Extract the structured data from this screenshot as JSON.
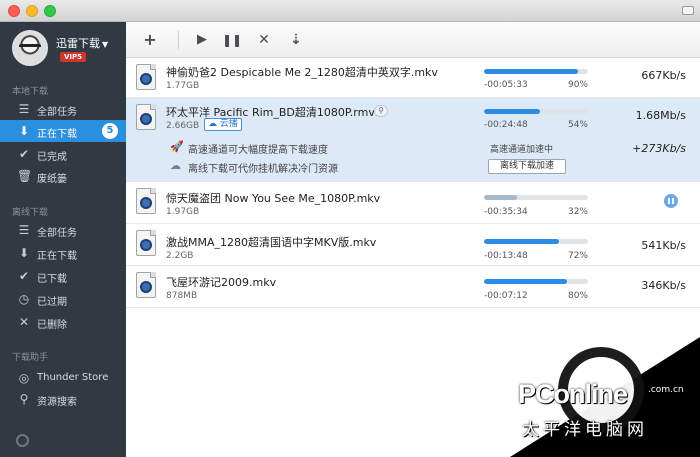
{
  "user": {
    "name": "迅雷下载",
    "vip": "VIP5"
  },
  "sidebar": {
    "sections": [
      {
        "title": "本地下载",
        "items": [
          {
            "icon": "list-icon",
            "label": "全部任务"
          },
          {
            "icon": "download-icon",
            "label": "正在下载",
            "badge": "5"
          },
          {
            "icon": "check-icon",
            "label": "已完成"
          },
          {
            "icon": "trash-icon",
            "label": "废纸篓"
          }
        ]
      },
      {
        "title": "离线下载",
        "items": [
          {
            "icon": "list-icon",
            "label": "全部任务"
          },
          {
            "icon": "download-icon",
            "label": "正在下载"
          },
          {
            "icon": "check-icon",
            "label": "已下载"
          },
          {
            "icon": "clock-icon",
            "label": "已过期"
          },
          {
            "icon": "close-icon",
            "label": "已删除"
          }
        ]
      },
      {
        "title": "下载助手",
        "items": [
          {
            "icon": "thunder-store-icon",
            "label": "Thunder Store"
          },
          {
            "icon": "search-icon",
            "label": "资源搜索"
          }
        ]
      }
    ]
  },
  "toolbar": {
    "add": "+",
    "start": "▶",
    "pause": "❚❚",
    "delete": "✕",
    "sort": "⇣"
  },
  "tasks": [
    {
      "name": "神偷奶爸2 Despicable Me 2_1280超清中英双字.mkv",
      "size": "1.77GB",
      "eta": "-00:05:33",
      "percent": "90%",
      "progress": 0.9,
      "speed": "667Kb/s"
    },
    {
      "name": "环太平洋 Pacific Rim_BD超清1080P.rmvb",
      "size": "2.66GB",
      "eta": "-00:24:48",
      "percent": "54%",
      "progress": 0.54,
      "speed": "1.68Mb/s",
      "cloud_tag": "云播",
      "sub1": "高速通道可大幅度提高下载速度",
      "sub1_status": "高速通道加速中",
      "sub1_speed": "+273Kb/s",
      "sub2": "离线下载可代你挂机解决冷门资源",
      "sub2_button": "离线下载加速"
    },
    {
      "name": "惊天魔盗团 Now You See Me_1080P.mkv",
      "size": "1.97GB",
      "eta": "-00:35:34",
      "percent": "32%",
      "progress": 0.32,
      "paused": true
    },
    {
      "name": "激战MMA_1280超清国语中字MKV版.mkv",
      "size": "2.2GB",
      "eta": "-00:13:48",
      "percent": "72%",
      "progress": 0.72,
      "speed": "541Kb/s"
    },
    {
      "name": "飞屋环游记2009.mkv",
      "size": "878MB",
      "eta": "-00:07:12",
      "percent": "80%",
      "progress": 0.8,
      "speed": "346Kb/s"
    }
  ],
  "watermark": {
    "brand": "PConline",
    "dotcom": ".com.cn",
    "cn": "太平洋电脑网"
  }
}
